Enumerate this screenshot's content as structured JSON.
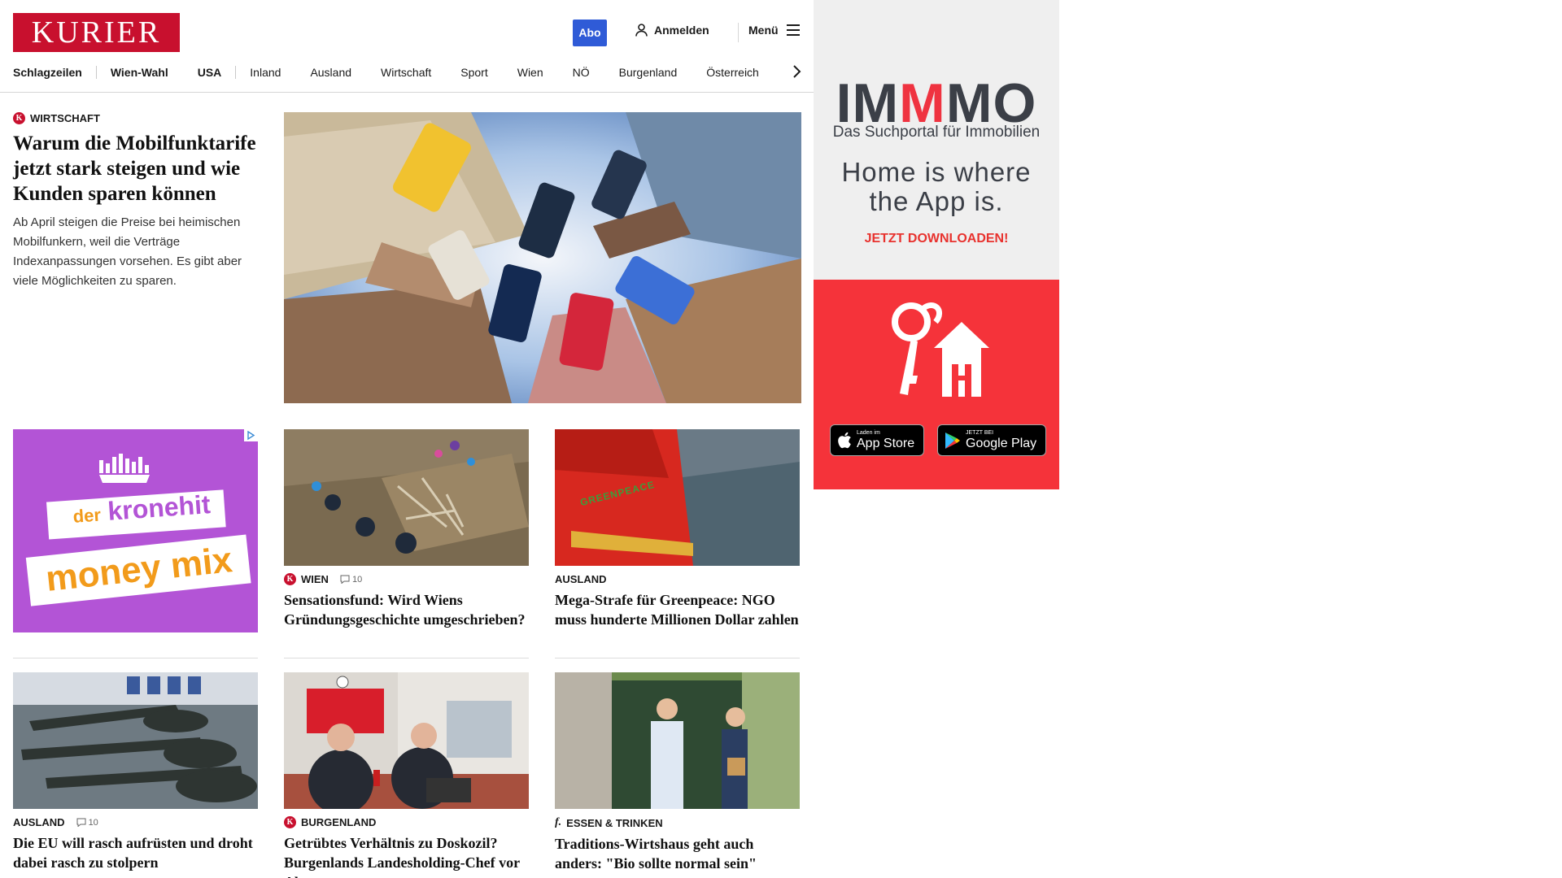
{
  "header": {
    "logo": "KURIER",
    "abo_label": "Abo",
    "login_label": "Anmelden",
    "menu_label": "Menü"
  },
  "nav": {
    "items": [
      "Schlagzeilen",
      "Wien-Wahl",
      "USA",
      "Inland",
      "Ausland",
      "Wirtschaft",
      "Sport",
      "Wien",
      "NÖ",
      "Burgenland",
      "Österreich"
    ]
  },
  "lead": {
    "badge": "K",
    "kicker": "WIRTSCHAFT",
    "headline": "Warum die Mobilfunktarife jetzt stark steigen und wie Kunden sparen können",
    "teaser": "Ab April steigen die Preise bei heimischen Mobilfunkern, weil die Verträge Indexanpassungen vorsehen. Es gibt aber viele Möglichkeiten zu sparen."
  },
  "ad_left": {
    "line1": "der",
    "line2": "kronehit",
    "line3": "money mix"
  },
  "cards": [
    {
      "badge": "K",
      "kicker": "WIEN",
      "comments": "10",
      "headline": "Sensationsfund: Wird Wiens Gründungsgeschichte umgeschrieben?"
    },
    {
      "badge": "",
      "kicker": "AUSLAND",
      "comments": "",
      "headline": "Mega-Strafe für Greenpeace: NGO muss hunderte Millionen Dollar zahlen",
      "image_text": "GREENPEACE"
    },
    {
      "badge": "",
      "kicker": "AUSLAND",
      "comments": "10",
      "headline": "Die EU will rasch aufrüsten und droht dabei rasch zu stolpern"
    },
    {
      "badge": "K",
      "kicker": "BURGENLAND",
      "comments": "",
      "headline": "Getrübtes Verhältnis zu Doskozil? Burgenlands Landesholding-Chef vor Abgang"
    },
    {
      "badge": "f.",
      "kicker": "ESSEN & TRINKEN",
      "comments": "",
      "headline": "Traditions-Wirtshaus geht auch anders: \"Bio sollte normal sein\""
    }
  ],
  "sky_ad": {
    "logo_a": "IM",
    "logo_m": "M",
    "logo_b": "MO",
    "subtitle": "Das Suchportal für Immobilien",
    "slogan": "Home is where the App is.",
    "cta": "JETZT DOWNLOADEN!",
    "appstore_small": "Laden im",
    "appstore_big": "App Store",
    "play_small": "JETZT BEI",
    "play_big": "Google Play"
  },
  "colors": {
    "brand_red": "#c8102e",
    "abo_blue": "#2f5bd7",
    "immmo_red": "#f5333a",
    "kronehit_purple": "#b354d6"
  },
  "icons": [
    "user-icon",
    "hamburger-icon",
    "chevron-right-icon",
    "comment-icon",
    "adchoices-icon",
    "apple-icon",
    "google-play-icon",
    "house-key-icon"
  ]
}
